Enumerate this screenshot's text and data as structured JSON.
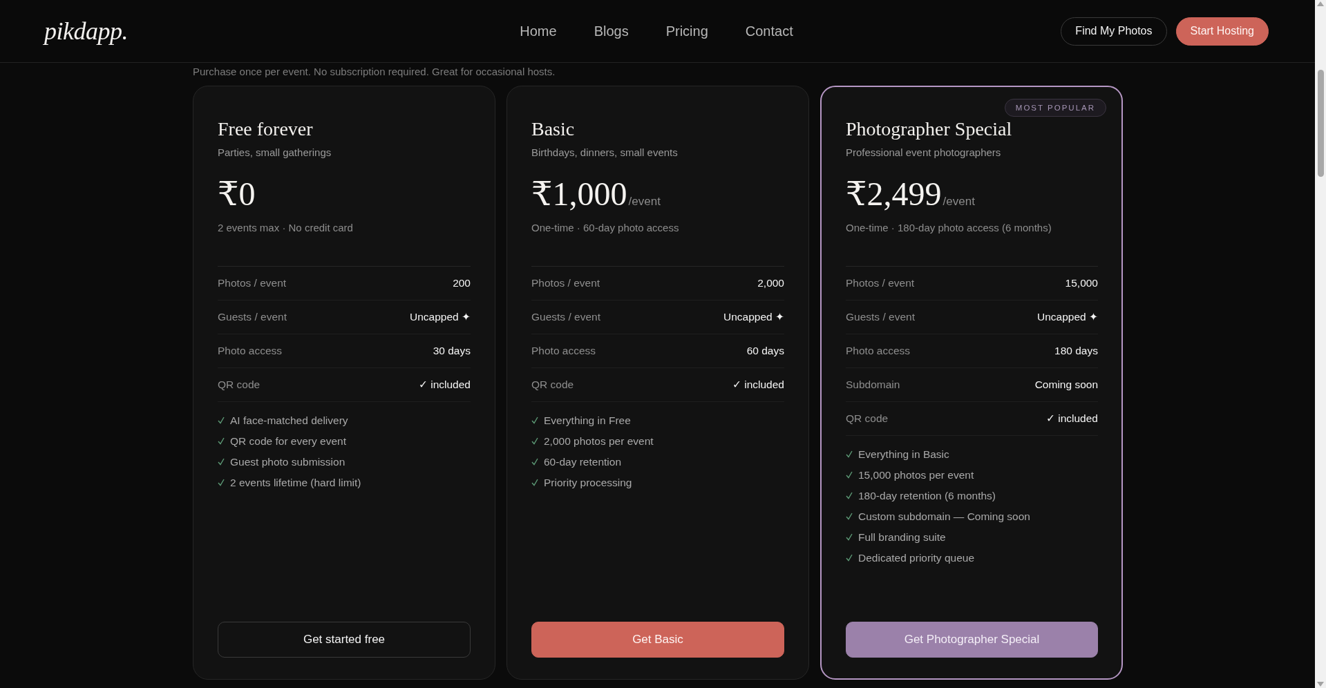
{
  "header": {
    "logo": "pikdapp.",
    "nav": [
      {
        "label": "Home",
        "selected": false
      },
      {
        "label": "Blogs",
        "selected": false
      },
      {
        "label": "Pricing",
        "selected": false
      },
      {
        "label": "Contact",
        "selected": false
      }
    ],
    "buttons": [
      {
        "label": "Find My Photos",
        "kind": "outline"
      },
      {
        "label": "Start Hosting",
        "kind": "coral"
      }
    ]
  },
  "intro": "Purchase once per event. No subscription required. Great for occasional hosts.",
  "plans": [
    {
      "name": "Free forever",
      "audience": "Parties, small gatherings",
      "price": "₹0",
      "note": "2 events max · No credit card",
      "featured": false,
      "specs": [
        {
          "label": "Photos / event",
          "value": "200"
        },
        {
          "label": "Guests / event",
          "value": "Uncapped ✦"
        },
        {
          "label": "Photo access",
          "value": "30 days"
        },
        {
          "label": "QR code",
          "value": "✓ included"
        }
      ],
      "features": [
        "AI face-matched delivery",
        "QR code for every event",
        "Guest photo submission",
        "2 events lifetime (hard limit)"
      ],
      "cta": {
        "label": "Get started free",
        "kind": "outline"
      }
    },
    {
      "name": "Basic",
      "audience": "Birthdays, dinners, small events",
      "price": "₹1,000",
      "unit": "/event",
      "note": "One-time · 60-day photo access",
      "featured": false,
      "specs": [
        {
          "label": "Photos / event",
          "value": "2,000"
        },
        {
          "label": "Guests / event",
          "value": "Uncapped ✦"
        },
        {
          "label": "Photo access",
          "value": "60 days"
        },
        {
          "label": "QR code",
          "value": "✓ included"
        }
      ],
      "features": [
        "Everything in Free",
        "2,000 photos per event",
        "60-day retention",
        "Priority processing"
      ],
      "cta": {
        "label": "Get Basic",
        "kind": "coral"
      }
    },
    {
      "name": "Photographer Special",
      "audience": "Professional event photographers",
      "price": "₹2,499",
      "unit": "/event",
      "note": "One-time · 180-day photo access (6 months)",
      "featured": true,
      "badge": "MOST POPULAR",
      "specs": [
        {
          "label": "Photos / event",
          "value": "15,000"
        },
        {
          "label": "Guests / event",
          "value": "Uncapped ✦"
        },
        {
          "label": "Photo access",
          "value": "180 days"
        },
        {
          "label": "Subdomain",
          "value": "Coming soon"
        },
        {
          "label": "QR code",
          "value": "✓ included"
        }
      ],
      "features": [
        "Everything in Basic",
        "15,000 photos per event",
        "180-day retention (6 months)",
        "Custom subdomain — Coming soon",
        "Full branding suite",
        "Dedicated priority queue"
      ],
      "cta": {
        "label": "Get Photographer Special",
        "kind": "purple"
      }
    }
  ]
}
